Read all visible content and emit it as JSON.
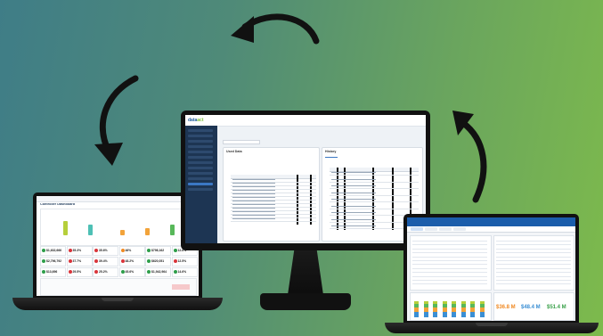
{
  "arrows": [
    "curved-arrow-top",
    "curved-arrow-left",
    "curved-arrow-right"
  ],
  "colors": {
    "brand_blue": "#1b5a9a",
    "brand_green": "#7bbf3a",
    "kpi_green": "#2e9e4a",
    "kpi_red": "#d9343a",
    "kpi_orange": "#f08a24",
    "bar_lime": "#b6cf3b",
    "bar_teal": "#4ec0b5",
    "bar_orange": "#f2a33a",
    "bar_green": "#58b85a",
    "num_orange": "#f08a24",
    "num_blue": "#3b8fd4",
    "num_green": "#3aa14a"
  },
  "monitor": {
    "logo_prefix": "data",
    "logo_suffix": "act",
    "left_panel_title": "Used Data",
    "right_panel_title": "History"
  },
  "laptop_left": {
    "title": "Controller Dashboard",
    "kpis": [
      {
        "value": "$1,632,666",
        "status": "green"
      },
      {
        "value": "35.3%",
        "status": "red"
      },
      {
        "value": "35.6%",
        "status": "red"
      },
      {
        "value": "46%",
        "status": "orange"
      },
      {
        "value": "$798,162",
        "status": "green"
      },
      {
        "value": "12.6%",
        "status": "green"
      },
      {
        "value": "$2,796,792",
        "status": "green"
      },
      {
        "value": "37.7%",
        "status": "red"
      },
      {
        "value": "39.4%",
        "status": "red"
      },
      {
        "value": "48.2%",
        "status": "red"
      },
      {
        "value": "$620,051",
        "status": "green"
      },
      {
        "value": "12.5%",
        "status": "red"
      },
      {
        "value": "$13,696",
        "status": "green"
      },
      {
        "value": "29.5%",
        "status": "red"
      },
      {
        "value": "25.2%",
        "status": "red"
      },
      {
        "value": "45.6%",
        "status": "green"
      },
      {
        "value": "$1,942,964",
        "status": "green"
      },
      {
        "value": "14.6%",
        "status": "green"
      }
    ]
  },
  "laptop_right": {
    "numbers": [
      {
        "value": "$36.8 M",
        "color": "#f08a24"
      },
      {
        "value": "$48.4 M",
        "color": "#3b8fd4"
      },
      {
        "value": "$51.4 M",
        "color": "#3aa14a"
      }
    ]
  }
}
